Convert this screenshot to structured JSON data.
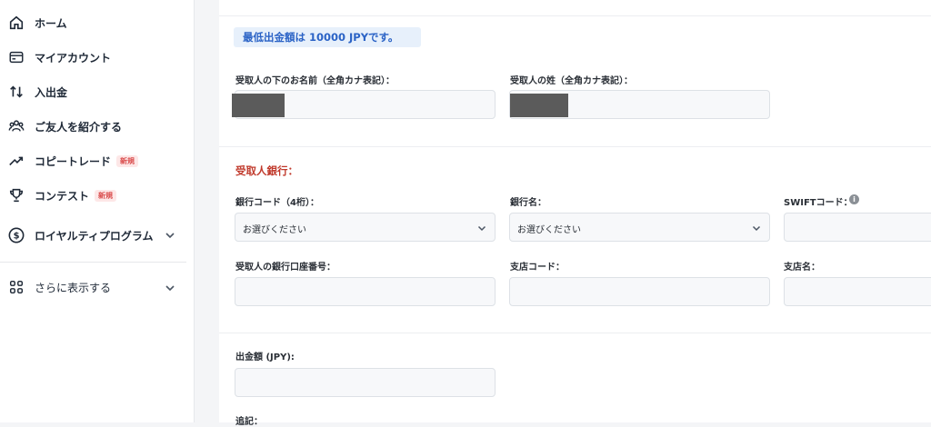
{
  "sidebar": {
    "items": [
      {
        "label": "ホーム"
      },
      {
        "label": "マイアカウント"
      },
      {
        "label": "入出金"
      },
      {
        "label": "ご友人を紹介する"
      },
      {
        "label": "コピートレード",
        "badge": "新規"
      },
      {
        "label": "コンテスト",
        "badge": "新規"
      },
      {
        "label": "ロイヤルティプログラム"
      },
      {
        "label": "さらに表示する"
      }
    ]
  },
  "form": {
    "min_notice": "最低出金額は 10000 JPYです。",
    "first_name_label": "受取人の下のお名前（全角カナ表記）：",
    "last_name_label": "受取人の姓（全角カナ表記）：",
    "bank_section_title": "受取人銀行：",
    "bank_code_label": "銀行コード（4桁）：",
    "bank_code_value": "お選びください",
    "bank_name_label": "銀行名：",
    "bank_name_value": "お選びください",
    "swift_label": "SWIFTコード：",
    "account_number_label": "受取人の銀行口座番号：",
    "branch_code_label": "支店コード：",
    "branch_name_label": "支店名：",
    "amount_label": "出金額 (JPY):",
    "notes_label": "追記："
  },
  "colors": {
    "notice_bg": "#e7f0fb",
    "notice_text": "#2b63c6",
    "section_title": "#c0392b",
    "badge": "#d94a4a"
  }
}
